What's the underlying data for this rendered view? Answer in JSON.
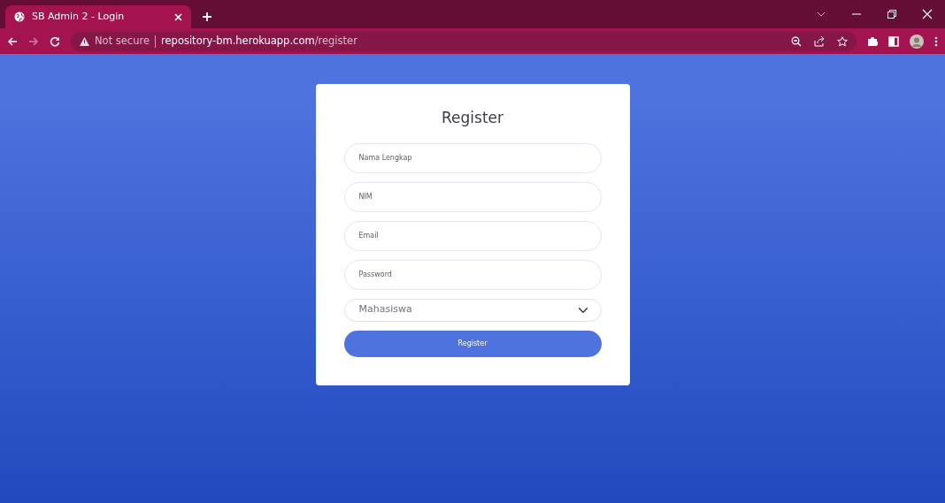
{
  "browser": {
    "tabs": [
      {
        "title": "SB Admin 2 - Login",
        "selected": true
      }
    ],
    "address": {
      "security": "Not secure",
      "host": "repository-bm.herokuapp.com",
      "path": "/register"
    }
  },
  "form": {
    "title": "Register",
    "fields": [
      {
        "kind": "input",
        "placeholder": "Nama Lengkap"
      },
      {
        "kind": "input",
        "placeholder": "NIM"
      },
      {
        "kind": "input",
        "placeholder": "Email"
      },
      {
        "kind": "input",
        "placeholder": "Password"
      },
      {
        "kind": "select",
        "value": "Mahasiswa"
      }
    ],
    "button": "Register"
  }
}
